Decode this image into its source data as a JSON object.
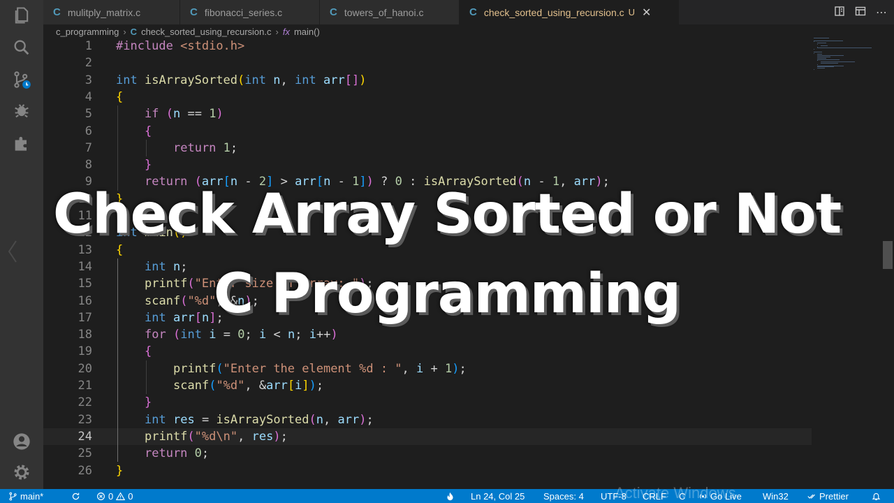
{
  "tabs": [
    {
      "label": "mulitply_matrix.c",
      "icon": "C"
    },
    {
      "label": "fibonacci_series.c",
      "icon": "C"
    },
    {
      "label": "towers_of_hanoi.c",
      "icon": "C"
    },
    {
      "label": "check_sorted_using_recursion.c",
      "icon": "C",
      "status": "U",
      "active": true
    }
  ],
  "breadcrumb": {
    "folder": "c_programming",
    "file_icon": "C",
    "file": "check_sorted_using_recursion.c",
    "symbol_icon": "fx",
    "symbol": "main()"
  },
  "code_lines": [
    "#include <stdio.h>",
    "",
    "int isArraySorted(int n, int arr[])",
    "{",
    "    if (n == 1)",
    "    {",
    "        return 1;",
    "    }",
    "    return (arr[n - 2] > arr[n - 1]) ? 0 : isArraySorted(n - 1, arr);",
    "}",
    "",
    "int main()",
    "{",
    "    int n;",
    "    printf(\"Enter size of array: \");",
    "    scanf(\"%d\", &n);",
    "    int arr[n];",
    "    for (int i = 0; i < n; i++)",
    "    {",
    "        printf(\"Enter the element %d : \", i + 1);",
    "        scanf(\"%d\", &arr[i]);",
    "    }",
    "    int res = isArraySorted(n, arr);",
    "    printf(\"%d\\n\", res);",
    "    return 0;",
    "}"
  ],
  "current_line": 24,
  "overlay": {
    "line1": "Check Array Sorted or Not",
    "line2": "C Programming"
  },
  "status_bar": {
    "branch": "main*",
    "errors": "0",
    "warnings": "0",
    "position": "Ln 24, Col 25",
    "spaces": "Spaces: 4",
    "encoding": "UTF-8",
    "eol": "CRLF",
    "language": "C",
    "go_live": "Go Live",
    "platform": "Win32",
    "prettier": "Prettier"
  },
  "watermark": "Activate Windows",
  "icons": {
    "activity": [
      "explorer-icon",
      "search-icon",
      "source-control-icon",
      "debug-icon",
      "extensions-icon",
      "account-icon",
      "settings-icon"
    ]
  },
  "colors": {
    "accent": "#007acc",
    "editor_bg": "#1e1e1e",
    "activity_bg": "#333333",
    "keyword": "#569cd6",
    "function": "#dcdcaa",
    "variable": "#9cdcfe",
    "number": "#b5cea8",
    "string": "#ce9178",
    "modified_tab": "#e2c08d"
  }
}
